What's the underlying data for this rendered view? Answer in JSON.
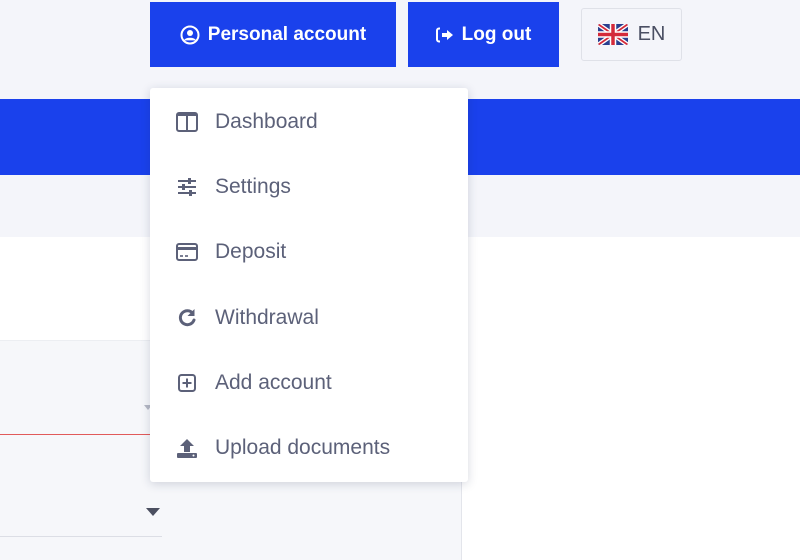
{
  "header": {
    "personal_account_label": "Personal account",
    "logout_label": "Log out",
    "language_code": "EN"
  },
  "dropdown": {
    "items": [
      {
        "label": "Dashboard",
        "icon": "columns-icon"
      },
      {
        "label": "Settings",
        "icon": "sliders-icon"
      },
      {
        "label": "Deposit",
        "icon": "credit-card-icon"
      },
      {
        "label": "Withdrawal",
        "icon": "redo-icon"
      },
      {
        "label": "Add account",
        "icon": "plus-square-icon"
      },
      {
        "label": "Upload documents",
        "icon": "upload-icon"
      }
    ]
  },
  "colors": {
    "brand_blue": "#1a41ec",
    "menu_text": "#5c6179",
    "background_grey": "#f4f5fa",
    "error_red": "#e15a5a"
  }
}
